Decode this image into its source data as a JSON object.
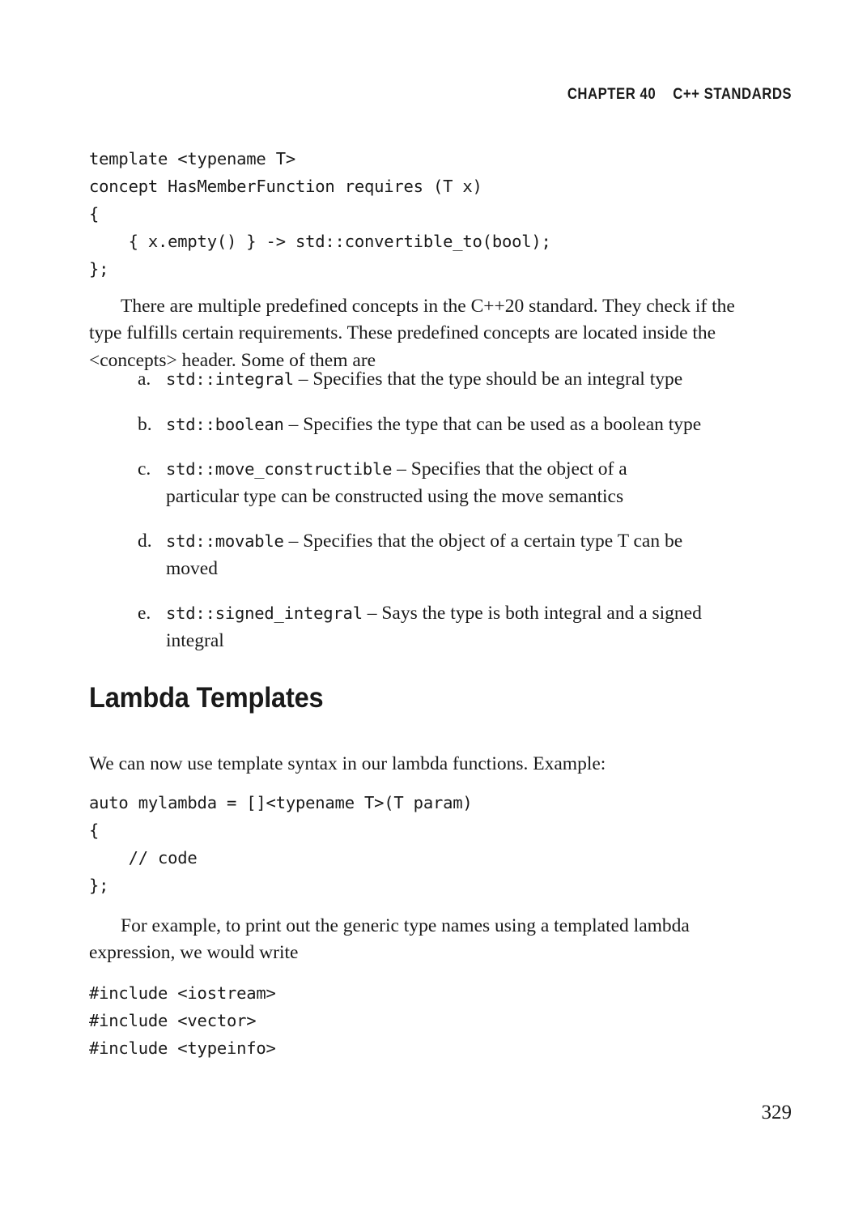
{
  "running_head": {
    "chapter": "CHAPTER 40",
    "title": "C++ STANDARDS"
  },
  "code_block_1": "template <typename T>\nconcept HasMemberFunction requires (T x)\n{\n    { x.empty() } -> std::convertible_to(bool);\n};",
  "paragraph_1": "There are multiple predefined concepts in the C++20 standard. They check if the type fulfills certain requirements. These predefined concepts are located inside the <concepts> header. Some of them are",
  "list": [
    {
      "marker": "a.",
      "code": "std::integral",
      "description": " – Specifies that the type should be an integral type"
    },
    {
      "marker": "b.",
      "code": "std::boolean",
      "description": " – Specifies the type that can be used as a boolean type"
    },
    {
      "marker": "c.",
      "code": "std::move_constructible",
      "description": " – Specifies that the object of a particular type can be constructed using the move semantics"
    },
    {
      "marker": "d.",
      "code": "std::movable",
      "description": " – Specifies that the object of a certain type T can be moved"
    },
    {
      "marker": "e.",
      "code": "std::signed_integral",
      "description": " – Says the type is both integral and a signed integral"
    }
  ],
  "section_heading": "Lambda Templates",
  "paragraph_2": "We can now use template syntax in our lambda functions. Example:",
  "code_block_2": "auto mylambda = []<typename T>(T param)\n{\n    // code\n};",
  "paragraph_3": "For example, to print out the generic type names using a templated lambda expression, we would write",
  "code_block_3": "#include <iostream>\n#include <vector>\n#include <typeinfo>",
  "page_number": "329"
}
